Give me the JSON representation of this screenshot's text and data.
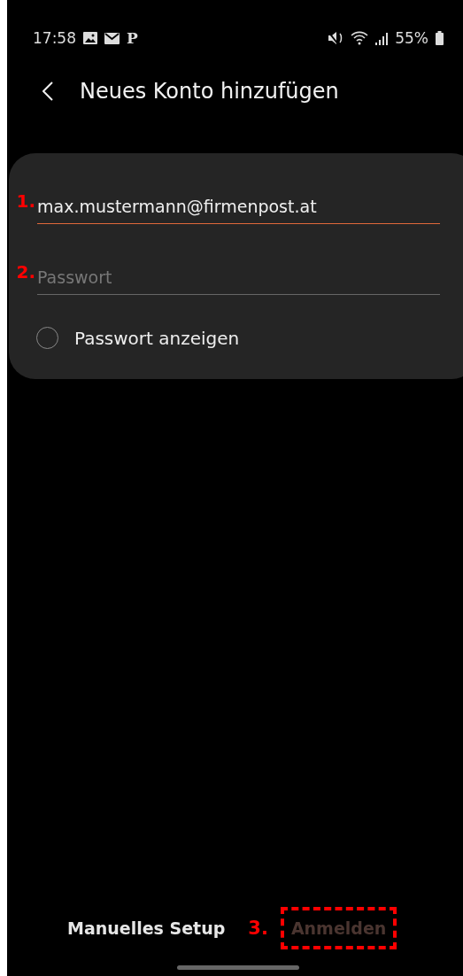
{
  "status_bar": {
    "time": "17:58",
    "notification_letter": "P",
    "battery": "55%"
  },
  "header": {
    "title": "Neues Konto hinzufügen"
  },
  "form": {
    "email": {
      "value": "max.mustermann@firmenpost.at",
      "focused": true
    },
    "password": {
      "placeholder": "Passwort",
      "focused": false
    },
    "show_password": {
      "label": "Passwort anzeigen",
      "checked": false
    }
  },
  "annotations": [
    {
      "label": "1."
    },
    {
      "label": "2."
    },
    {
      "label": "3."
    }
  ],
  "footer": {
    "manual_setup": "Manuelles Setup",
    "sign_in": {
      "label": "Anmelden",
      "disabled": true
    }
  }
}
